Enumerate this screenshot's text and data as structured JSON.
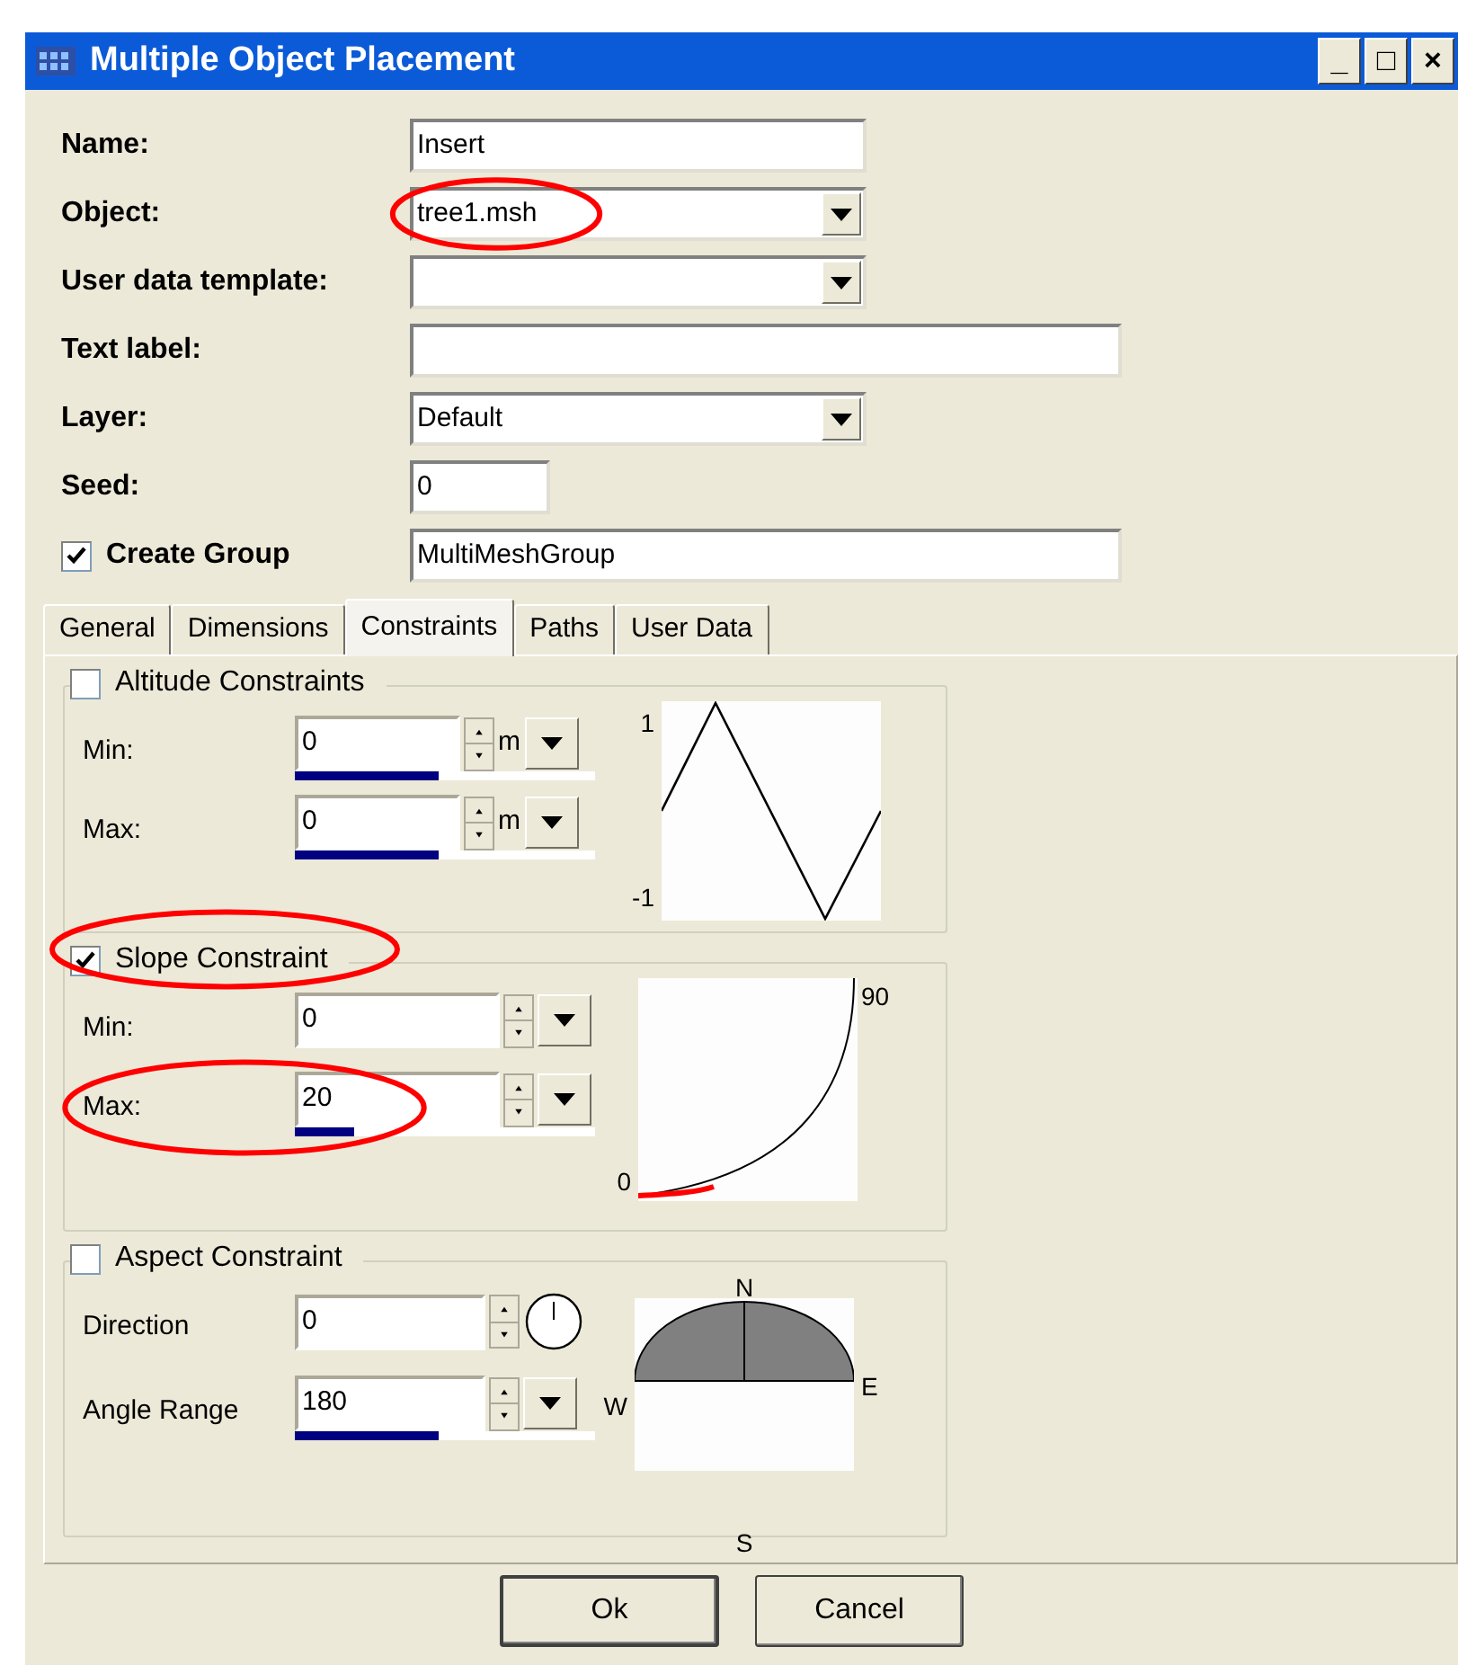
{
  "window": {
    "title": "Multiple Object Placement",
    "controls": [
      "_",
      "□",
      "×"
    ]
  },
  "form": [
    {
      "label": "Name:",
      "kind": "text",
      "value": "Insert",
      "circled": false
    },
    {
      "label": "Object:",
      "kind": "dropdown",
      "value": "tree1.msh",
      "circled": true
    },
    {
      "label": "User data template:",
      "kind": "dropdown",
      "circled": false
    },
    {
      "label": "Text label:",
      "kind": "wide",
      "circled": false
    },
    {
      "label": "Layer:",
      "kind": "dropdown",
      "value": "Default",
      "circled": false
    },
    {
      "label": "Seed:",
      "kind": "short",
      "value": "0",
      "circled": false
    }
  ],
  "create_group": {
    "label": "Create Group",
    "checked": true,
    "value": "MultiMeshGroup"
  },
  "tabs": [
    {
      "label": "General",
      "selected": false
    },
    {
      "label": "Dimensions",
      "selected": false
    },
    {
      "label": "Constraints",
      "selected": true
    },
    {
      "label": "Paths",
      "selected": false
    },
    {
      "label": "User Data",
      "selected": false
    }
  ],
  "groups": [
    {
      "kind": "altitude",
      "title": "Altitude Constraints",
      "checked": false,
      "circled": false,
      "rows": [
        {
          "label": "Min:",
          "value": "0",
          "unit": "m",
          "level": 0.48,
          "circled": false
        },
        {
          "label": "Max:",
          "value": "0",
          "unit": "m",
          "level": 0.48,
          "circled": false
        }
      ],
      "graph_labels": [
        "1",
        "-1"
      ]
    },
    {
      "kind": "slope",
      "title": "Slope Constraint",
      "checked": true,
      "circled": true,
      "rows": [
        {
          "label": "Min:",
          "value": "0",
          "circled": false
        },
        {
          "label": "Max:",
          "value": "20",
          "level": 0.2,
          "circled": true
        }
      ],
      "graph_labels": [
        "90",
        "0"
      ]
    },
    {
      "kind": "aspect",
      "title": "Aspect Constraint",
      "checked": false,
      "circled": false,
      "rows": [
        {
          "label": "Direction",
          "value": "0",
          "dial": true,
          "circled": false
        },
        {
          "label": "Angle Range",
          "value": "180",
          "level": 0.48,
          "circled": false
        }
      ],
      "graph_labels": [
        "N",
        "W",
        "E",
        "S"
      ]
    }
  ],
  "buttons": [
    "Ok",
    "Cancel"
  ]
}
